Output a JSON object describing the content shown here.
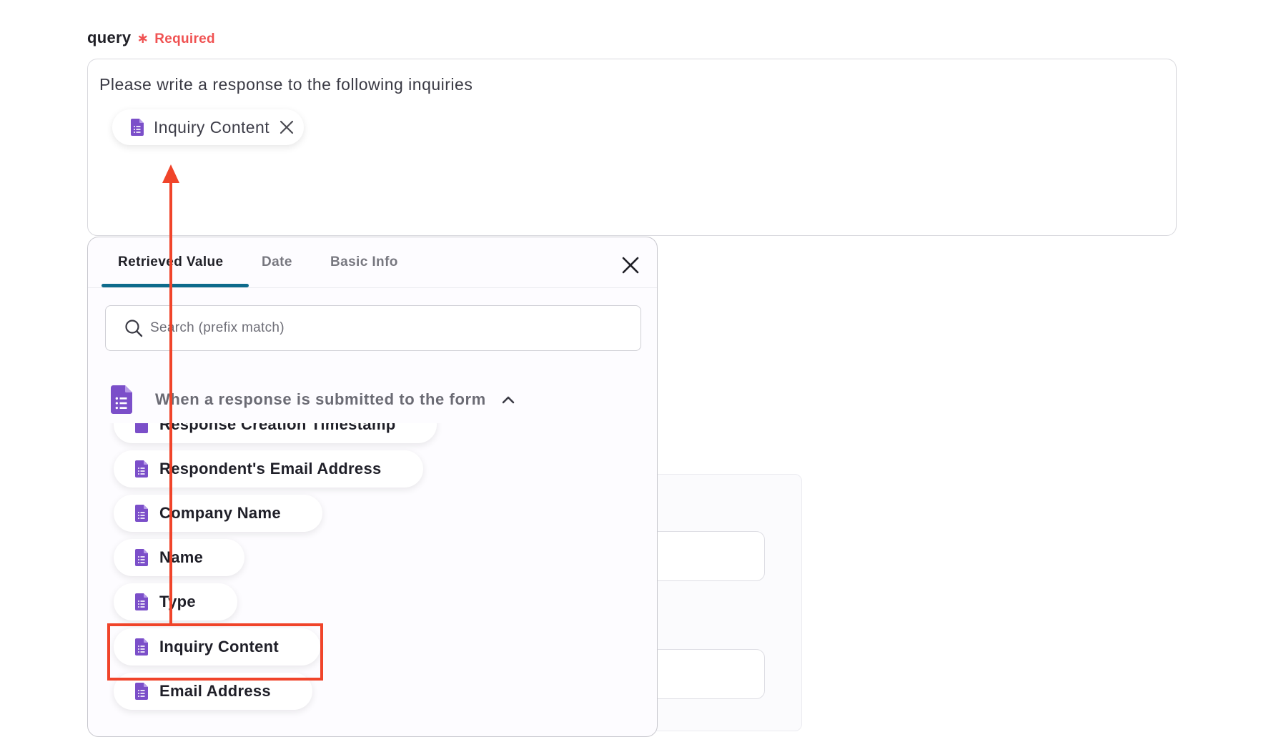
{
  "field": {
    "name": "query",
    "required_mark": "∗",
    "required_label": "Required"
  },
  "query_box": {
    "text": "Please write a response to the following inquiries",
    "chip_label": "Inquiry Content"
  },
  "dropdown": {
    "tabs": [
      {
        "label": "Retrieved Value",
        "active": true
      },
      {
        "label": "Date",
        "active": false
      },
      {
        "label": "Basic Info",
        "active": false
      }
    ],
    "search_placeholder": "Search (prefix match)",
    "section_title": "When a response is submitted to the form",
    "section_expanded": true,
    "items": [
      {
        "label": "Response Creation Timestamp",
        "partially_hidden": true
      },
      {
        "label": "Respondent's Email Address"
      },
      {
        "label": "Company Name"
      },
      {
        "label": "Name"
      },
      {
        "label": "Type"
      },
      {
        "label": "Inquiry Content",
        "highlighted": true
      },
      {
        "label": "Email Address"
      }
    ]
  },
  "colors": {
    "accent_underline": "#0e6b8c",
    "form_icon": "#7b4fc9",
    "required": "#f05252",
    "annotation": "#f0442a"
  },
  "icons": {
    "form_item": "google-forms-doc-icon",
    "chip_remove": "close-icon",
    "dropdown_close": "close-icon",
    "search": "search-icon",
    "collapse": "chevron-up-icon"
  }
}
